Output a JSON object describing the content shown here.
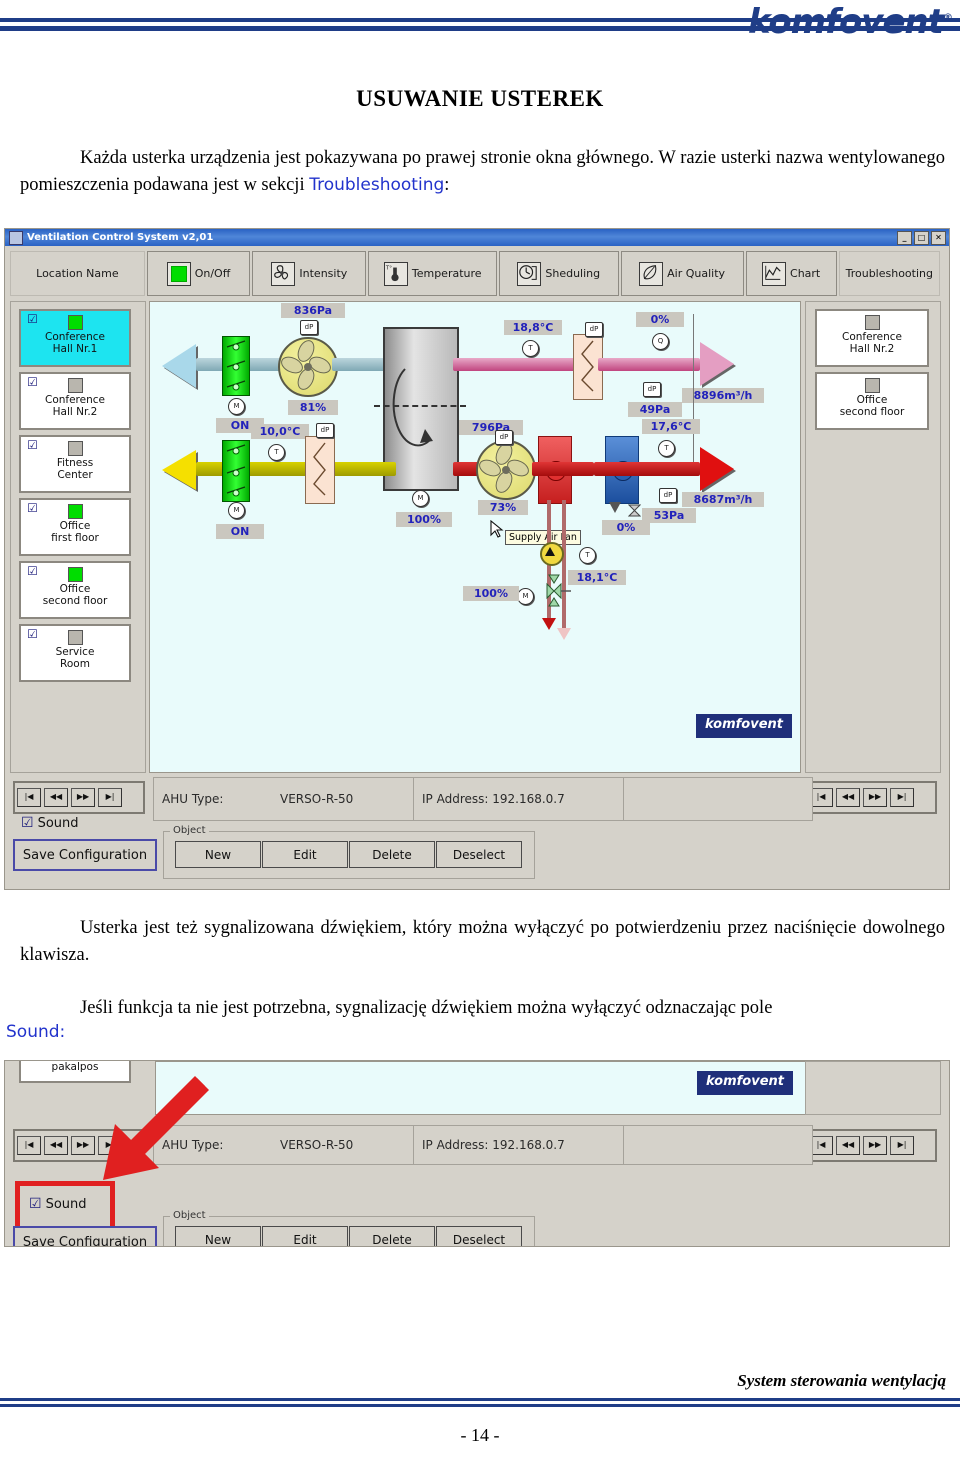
{
  "header": {
    "logo": "komfovent",
    "logo_mark": "®"
  },
  "document": {
    "title": "USUWANIE USTEREK",
    "para1_a": "Każda usterka urządzenia jest pokazywana po prawej stronie okna głównego. W razie usterki nazwa wentylowanego pomieszczenia podawana jest w sekcji ",
    "para1_blue": "Troubleshooting",
    "para1_b": ":",
    "para2": "Usterka jest też sygnalizowana dźwiękiem, który można wyłączyć po potwierdzeniu przez naciśnięcie dowolnego klawisza.",
    "para3": "Jeśli funkcja ta nie jest potrzebna, sygnalizację dźwiękiem można wyłączyć odznaczając pole",
    "sound_label": "Sound:",
    "footer_text": "System sterowania wentylacją",
    "page_number": "- 14 -"
  },
  "app": {
    "title": "Ventilation Control System v2,01",
    "window_buttons": {
      "minimize": "_",
      "maximize": "□",
      "close": "✕"
    },
    "toolbar": [
      {
        "label": "Location Name",
        "icon": "none"
      },
      {
        "label": "On/Off",
        "icon": "green-led-icon"
      },
      {
        "label": "Intensity",
        "icon": "fan-icon"
      },
      {
        "label": "Temperature",
        "icon": "thermometer-icon"
      },
      {
        "label": "Sheduling",
        "icon": "clock-icon"
      },
      {
        "label": "Air Quality",
        "icon": "leaf-icon"
      },
      {
        "label": "Chart",
        "icon": "chart-icon"
      },
      {
        "label": "Troubleshooting",
        "icon": "none"
      }
    ],
    "rooms_left": [
      {
        "line1": "Conference",
        "line2": "Hall Nr.1",
        "led": "on",
        "checked": true,
        "selected": true
      },
      {
        "line1": "Conference",
        "line2": "Hall Nr.2",
        "led": "off",
        "checked": true,
        "selected": false
      },
      {
        "line1": "Fitness",
        "line2": "Center",
        "led": "off",
        "checked": true,
        "selected": false
      },
      {
        "line1": "Office",
        "line2": "first floor",
        "led": "on",
        "checked": true,
        "selected": false
      },
      {
        "line1": "Office",
        "line2": "second floor",
        "led": "on",
        "checked": true,
        "selected": false
      },
      {
        "line1": "Service",
        "line2": "Room",
        "led": "off",
        "checked": true,
        "selected": false
      }
    ],
    "rooms_right": [
      {
        "line1": "Conference",
        "line2": "Hall Nr.2",
        "led": "off"
      },
      {
        "line1": "Office",
        "line2": "second floor",
        "led": "off"
      }
    ],
    "schematic": {
      "badge": "komfovent",
      "tooltip": "Supply Air Fan",
      "readouts": {
        "extract_filter_dp": "836Pa",
        "extract_fan_speed": "81%",
        "extract_damper": "ON",
        "outdoor_temp": "10,0°C",
        "supply_damper": "ON",
        "supply_filter_dp": "796Pa",
        "rotor_speed": "100%",
        "supply_fan_speed": "73%",
        "heater_valve": "100%",
        "water_temp": "18,1°C",
        "extract_air_temp": "18,8°C",
        "recirc_damper": "0%",
        "extract_duct_dp": "49Pa",
        "extract_airflow": "8896m³/h",
        "supply_air_temp": "17,6°C",
        "cooler_output": "0%",
        "supply_duct_dp": "53Pa",
        "supply_airflow": "8687m³/h"
      },
      "sensor_tags": {
        "dp": "dP",
        "temp": "T",
        "motor": "M",
        "quality": "Q"
      }
    },
    "status": {
      "ahu_type_label": "AHU Type:",
      "ahu_type_value": "VERSO-R-50",
      "ip_label": "IP Address: 192.168.0.7"
    },
    "nav_buttons": [
      "|◀",
      "◀◀",
      "▶▶",
      "▶|"
    ],
    "sound": {
      "label": "Sound",
      "checked": true
    },
    "save_button": "Save Configuration",
    "object_group": {
      "legend": "Object",
      "buttons": [
        "New",
        "Edit",
        "Delete",
        "Deselect"
      ]
    },
    "cutoff_card": "pakalpos"
  },
  "colors": {
    "brand_blue": "#1f3d87",
    "accent_blue": "#2233cc",
    "annotation_red": "#e02020",
    "led_green": "#00dd00",
    "canvas_bg": "#e9fbfb",
    "chrome_gray": "#d5d2ca"
  }
}
